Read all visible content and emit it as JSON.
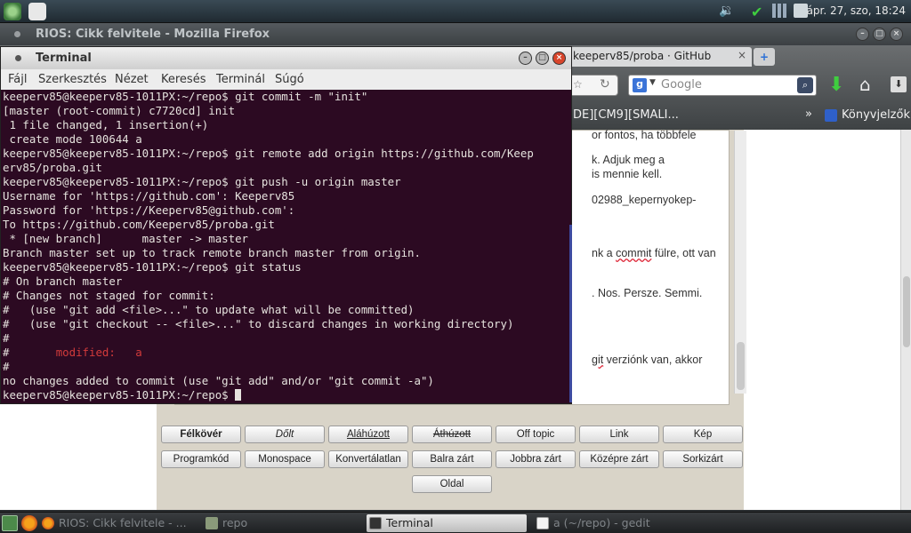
{
  "top_panel": {
    "clock": "ápr. 27, szo, 18:24",
    "icons": [
      "app-menu-icon",
      "settings-icon",
      "volume-icon",
      "network-icon",
      "signal-icon",
      "battery-icon"
    ]
  },
  "firefox": {
    "window_title": "RIOS: Cikk felvitele - Mozilla Firefox",
    "tab_title": "keeperv85/proba · GitHub",
    "search_placeholder": "Google",
    "search_engine_letter": "g",
    "bookmarks_text": "DE][CM9][SMALI...",
    "bookmarks_overflow": "»",
    "bookmarks_label": "Könyvjelzők",
    "page_text": [
      "or fontos, ha többfele",
      "k. Adjuk meg a",
      "is mennie kell.",
      "02988_kepernyokep-",
      "nk a ",
      "commit",
      " fülre, ott van",
      ". Nos. Persze. Semmi.",
      "git",
      " verziónk van, akkor"
    ],
    "format_buttons": {
      "bold": "Félkövér",
      "italic": "Dőlt",
      "underline": "Aláhúzott",
      "strike": "Áthúzott",
      "offtopic": "Off topic",
      "link": "Link",
      "image": "Kép",
      "code": "Programkód",
      "monospace": "Monospace",
      "unconvertible": "Konvertálatlan",
      "align_left": "Balra zárt",
      "align_right": "Jobbra zárt",
      "center": "Középre zárt",
      "justify": "Sorkizárt",
      "page": "Oldal"
    },
    "page_bottom_text": "..."
  },
  "terminal": {
    "title": "Terminal",
    "menu": [
      "Fájl",
      "Szerkesztés",
      "Nézet",
      "Keresés",
      "Terminál",
      "Súgó"
    ],
    "lines": [
      "keeperv85@keeperv85-1011PX:~/repo$ git commit -m \"init\"",
      "[master (root-commit) c7720cd] init",
      " 1 file changed, 1 insertion(+)",
      " create mode 100644 a",
      "keeperv85@keeperv85-1011PX:~/repo$ git remote add origin https://github.com/Keep",
      "erv85/proba.git",
      "keeperv85@keeperv85-1011PX:~/repo$ git push -u origin master",
      "Username for 'https://github.com': Keeperv85",
      "Password for 'https://Keeperv85@github.com':",
      "To https://github.com/Keeperv85/proba.git",
      " * [new branch]      master -> master",
      "Branch master set up to track remote branch master from origin.",
      "keeperv85@keeperv85-1011PX:~/repo$ git status",
      "# On branch master",
      "# Changes not staged for commit:",
      "#   (use \"git add <file>...\" to update what will be committed)",
      "#   (use \"git checkout -- <file>...\" to discard changes in working directory)",
      "#"
    ],
    "modified_prefix": "#       ",
    "modified_label": "modified:   a",
    "after_lines": [
      "#",
      "no changes added to commit (use \"git add\" and/or \"git commit -a\")"
    ],
    "prompt": "keeperv85@keeperv85-1011PX:~/repo$ "
  },
  "taskbar": {
    "tasks": [
      {
        "label": "RIOS: Cikk felvitele - ...",
        "active": false
      },
      {
        "label": "repo",
        "active": false
      },
      {
        "label": "Terminal",
        "active": true
      },
      {
        "label": "a (~/repo) - gedit",
        "active": false
      }
    ]
  },
  "colors": {
    "terminal_bg": "#2c0a22",
    "terminal_fg": "#e6e3de",
    "modified_red": "#d33b3b",
    "close_button": "#d8452b"
  }
}
